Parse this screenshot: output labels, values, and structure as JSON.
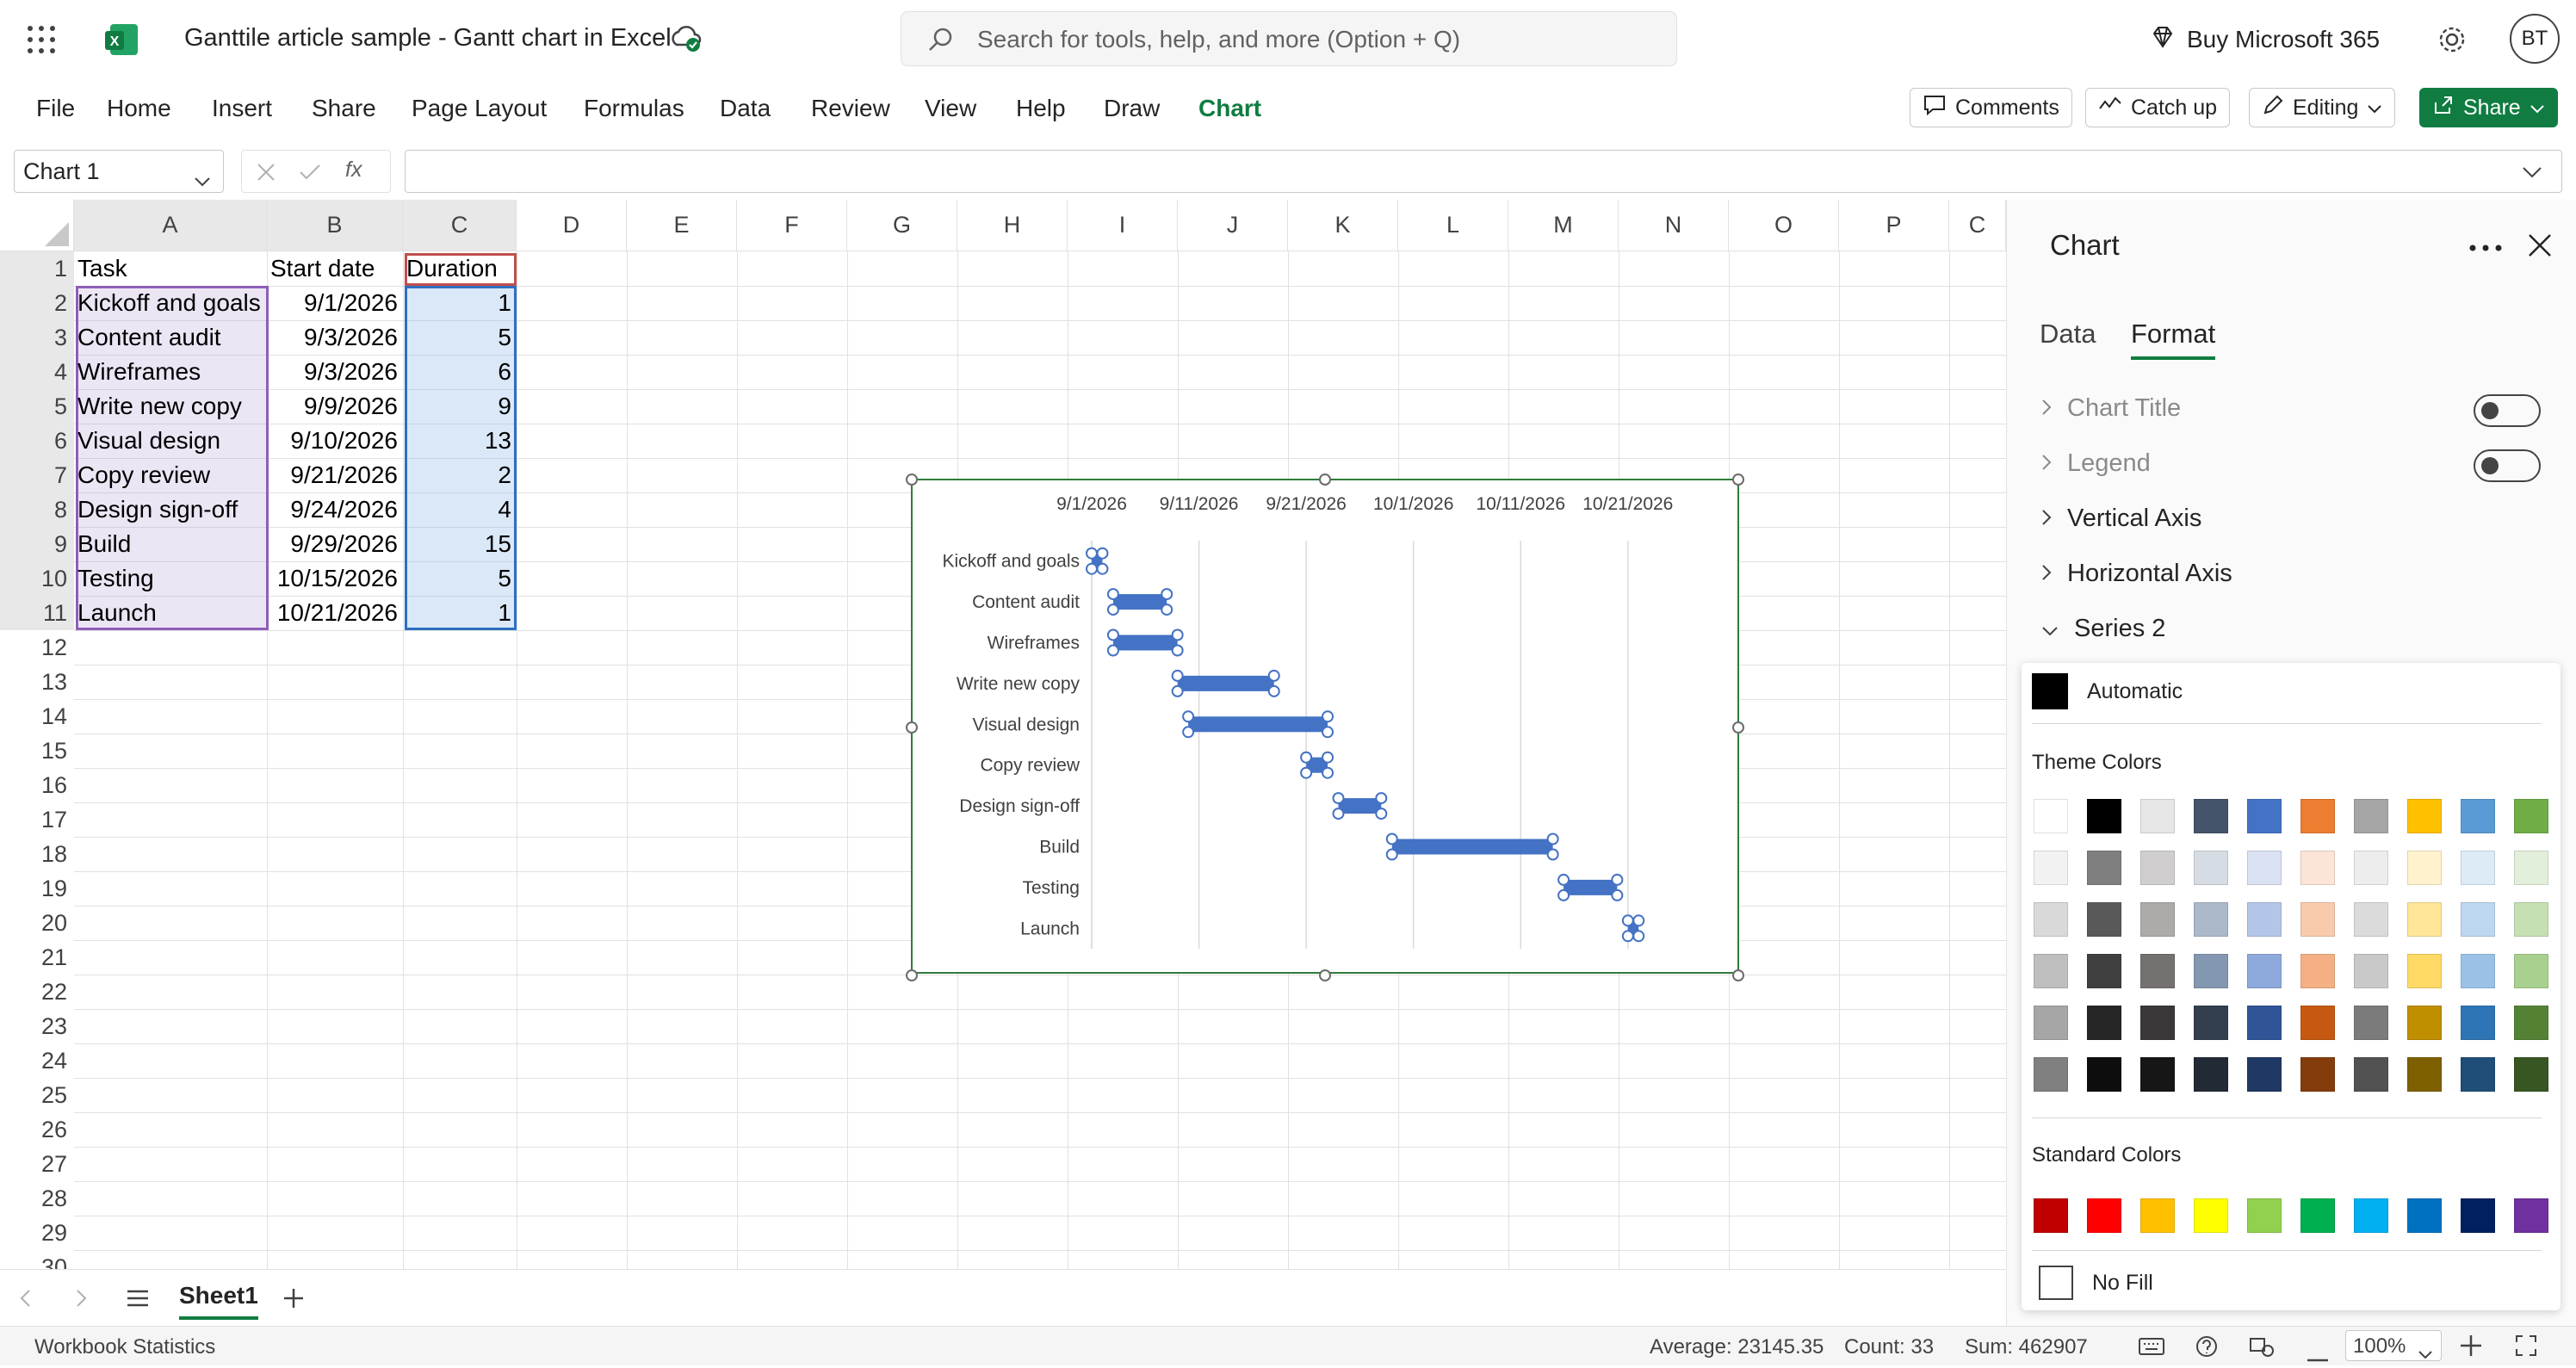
{
  "titlebar": {
    "doc_title": "Ganttile article sample - Gantt chart in Excel",
    "search_placeholder": "Search for tools, help, and more (Option + Q)",
    "buy_label": "Buy Microsoft 365",
    "avatar_initials": "BT"
  },
  "menu": [
    "File",
    "Home",
    "Insert",
    "Share",
    "Page Layout",
    "Formulas",
    "Data",
    "Review",
    "View",
    "Help",
    "Draw",
    "Chart"
  ],
  "active_menu": "Chart",
  "toolbar": {
    "comments": "Comments",
    "catchup": "Catch up",
    "editing": "Editing",
    "share": "Share"
  },
  "formula": {
    "namebox": "Chart 1",
    "fx": "fx",
    "value": ""
  },
  "columns": [
    "A",
    "B",
    "C",
    "D",
    "E",
    "F",
    "G",
    "H",
    "I",
    "J",
    "K",
    "L",
    "M",
    "N",
    "O",
    "P",
    "C"
  ],
  "rows": [
    "1",
    "2",
    "3",
    "4",
    "5",
    "6",
    "7",
    "8",
    "9",
    "10",
    "11",
    "12",
    "13",
    "14",
    "15",
    "16",
    "17",
    "18",
    "19",
    "20",
    "21",
    "22",
    "23",
    "24",
    "25",
    "26",
    "27",
    "28",
    "29",
    "30"
  ],
  "table": {
    "headers": [
      "Task",
      "Start date",
      "Duration"
    ],
    "rows": [
      [
        "Kickoff and goals",
        "9/1/2026",
        "1"
      ],
      [
        "Content audit",
        "9/3/2026",
        "5"
      ],
      [
        "Wireframes",
        "9/3/2026",
        "6"
      ],
      [
        "Write new copy",
        "9/9/2026",
        "9"
      ],
      [
        "Visual design",
        "9/10/2026",
        "13"
      ],
      [
        "Copy review",
        "9/21/2026",
        "2"
      ],
      [
        "Design sign-off",
        "9/24/2026",
        "4"
      ],
      [
        "Build",
        "9/29/2026",
        "15"
      ],
      [
        "Testing",
        "10/15/2026",
        "5"
      ],
      [
        "Launch",
        "10/21/2026",
        "1"
      ]
    ]
  },
  "chart_data": {
    "type": "bar",
    "orientation": "horizontal-stacked",
    "categories": [
      "Kickoff and goals",
      "Content audit",
      "Wireframes",
      "Write new copy",
      "Visual design",
      "Copy review",
      "Design sign-off",
      "Build",
      "Testing",
      "Launch"
    ],
    "x_ticks": [
      "9/1/2026",
      "9/11/2026",
      "9/21/2026",
      "10/1/2026",
      "10/11/2026",
      "10/21/2026"
    ],
    "x_tick_values": [
      "2026-09-01",
      "2026-09-11",
      "2026-09-21",
      "2026-10-01",
      "2026-10-11",
      "2026-10-21"
    ],
    "xlim": [
      "2026-09-01",
      "2026-10-28"
    ],
    "grid": true,
    "series": [
      {
        "values": [
          "2026-09-01",
          "2026-09-03",
          "2026-09-03",
          "2026-09-09",
          "2026-09-10",
          "2026-09-21",
          "2026-09-24",
          "2026-09-29",
          "2026-10-15",
          "2026-10-21"
        ],
        "color": "none"
      },
      {
        "values": [
          1,
          5,
          6,
          9,
          13,
          2,
          4,
          15,
          5,
          1
        ],
        "color": "#4472c4"
      }
    ]
  },
  "sheet": {
    "tab": "Sheet1"
  },
  "status": {
    "left": "Workbook Statistics",
    "average": "Average: 23145.35",
    "count": "Count: 33",
    "sum": "Sum: 462907",
    "zoom": "100%"
  },
  "pane": {
    "title": "Chart",
    "tabs": [
      "Data",
      "Format"
    ],
    "active_tab": "Format",
    "sections": [
      "Chart Title",
      "Legend",
      "Vertical Axis",
      "Horizontal Axis",
      "Series 2"
    ],
    "automatic_label": "Automatic",
    "theme_label": "Theme Colors",
    "standard_label": "Standard Colors",
    "nofill_label": "No Fill",
    "theme_colors": [
      [
        "#ffffff",
        "#000000",
        "#e7e6e6",
        "#44546a",
        "#4472c4",
        "#ed7d31",
        "#a5a5a5",
        "#ffc000",
        "#5b9bd5",
        "#70ad47"
      ],
      [
        "#f2f2f2",
        "#7f7f7f",
        "#d0cece",
        "#d6dce4",
        "#d9e1f2",
        "#fce4d6",
        "#ededed",
        "#fff2cc",
        "#ddebf7",
        "#e2efda"
      ],
      [
        "#d9d9d9",
        "#595959",
        "#aeaaaa",
        "#acb9ca",
        "#b4c6e7",
        "#f8cbad",
        "#dbdbdb",
        "#ffe699",
        "#bdd7ee",
        "#c6e0b4"
      ],
      [
        "#bfbfbf",
        "#404040",
        "#757171",
        "#8497b0",
        "#8ea9db",
        "#f4b084",
        "#c9c9c9",
        "#ffd966",
        "#9bc2e6",
        "#a9d08e"
      ],
      [
        "#a6a6a6",
        "#262626",
        "#3a3838",
        "#333f4f",
        "#2f5597",
        "#c65911",
        "#7b7b7b",
        "#bf8f00",
        "#2e75b6",
        "#548235"
      ],
      [
        "#808080",
        "#0d0d0d",
        "#161616",
        "#222b35",
        "#203864",
        "#843c0c",
        "#525252",
        "#7f6000",
        "#1f4e78",
        "#375623"
      ]
    ],
    "standard_colors": [
      "#c00000",
      "#ff0000",
      "#ffc000",
      "#ffff00",
      "#92d050",
      "#00b050",
      "#00b0f0",
      "#0070c0",
      "#002060",
      "#7030a0"
    ]
  }
}
